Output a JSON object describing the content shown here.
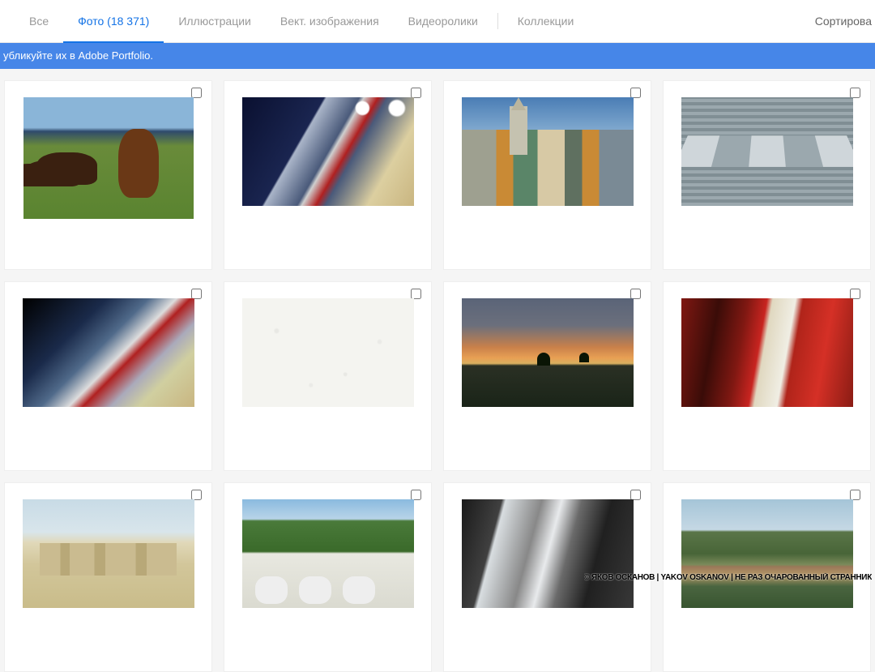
{
  "tabs": {
    "all": "Все",
    "photos": "Фото (18 371)",
    "illustrations": "Иллюстрации",
    "vectors": "Вект. изображения",
    "videos": "Видеоролики",
    "collections": "Коллекции"
  },
  "sort_label": "Сортирова",
  "banner_text": "убликуйте их в Adobe Portfolio.",
  "watermark": "© ЯКОВ ОСКАНОВ  | YAKOV OSKANOV  | НЕ РАЗ ОЧАРОВАННЫЙ СТРАННИК",
  "cards": [
    {
      "alt": "horse-in-field"
    },
    {
      "alt": "car-showroom-dark"
    },
    {
      "alt": "colonial-town-street"
    },
    {
      "alt": "industrial-tanks"
    },
    {
      "alt": "car-showroom-reflection"
    },
    {
      "alt": "white-floral-texture"
    },
    {
      "alt": "african-sunset-trees"
    },
    {
      "alt": "red-cars-showroom"
    },
    {
      "alt": "desert-buildings"
    },
    {
      "alt": "garden-patio-furniture"
    },
    {
      "alt": "grey-cars-rear"
    },
    {
      "alt": "green-valley-aerial"
    }
  ]
}
